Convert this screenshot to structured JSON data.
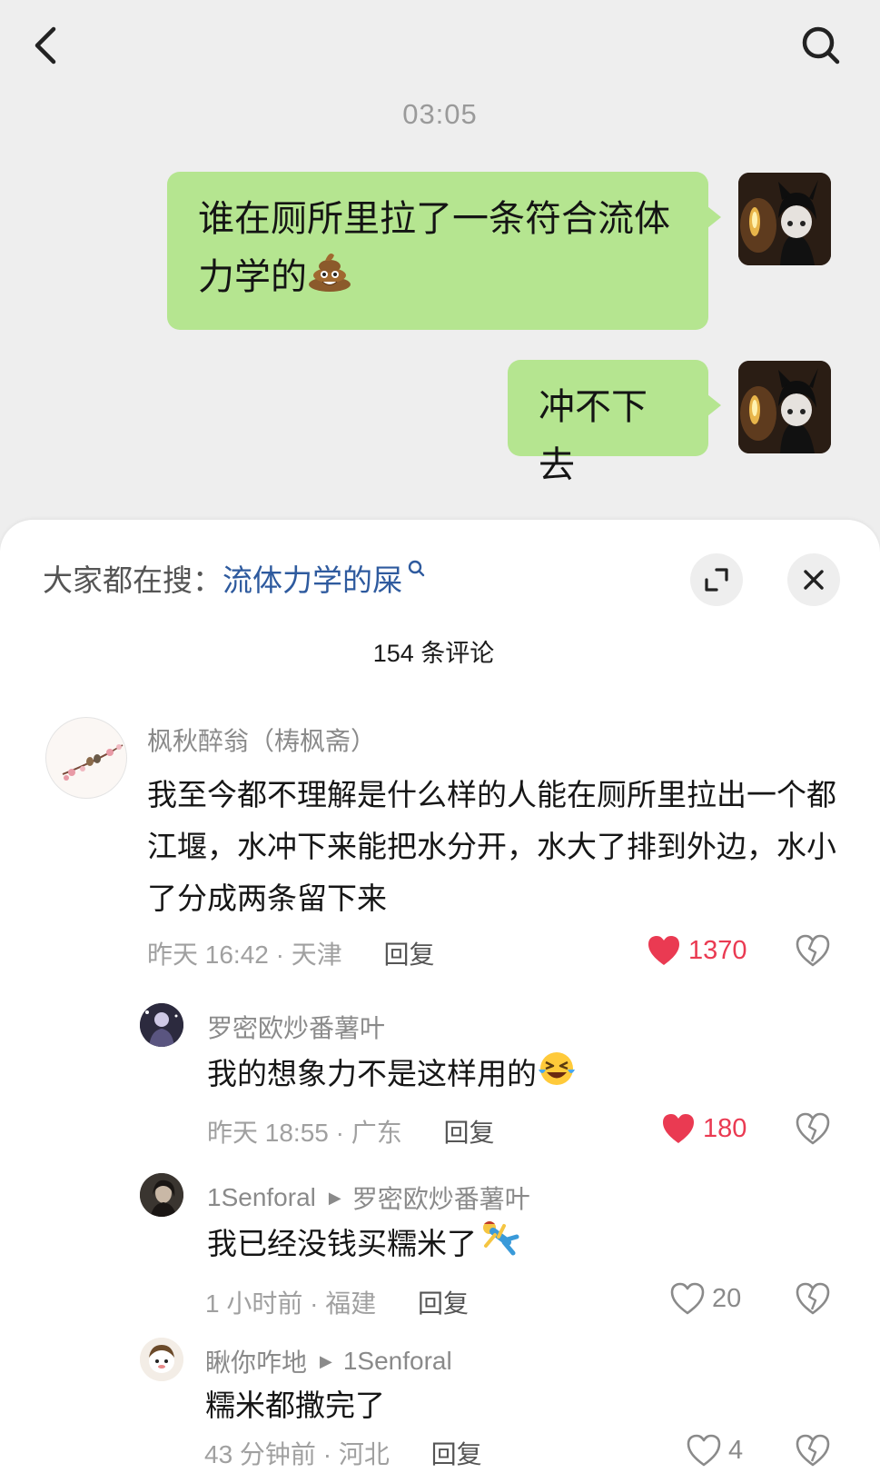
{
  "chat": {
    "time": "03:05",
    "messages": [
      {
        "text": "谁在厕所里拉了一条符合流体力学的",
        "emoji": "poop-emoji"
      },
      {
        "text": "冲不下去"
      }
    ]
  },
  "sheet": {
    "search_prefix": "大家都在搜：",
    "search_term": "流体力学的屎",
    "comment_count": "154 条评论"
  },
  "comments": [
    {
      "name": "枫秋醉翁（梼枫斋）",
      "text": "我至今都不理解是什么样的人能在厕所里拉出一个都江堰，水冲下来能把水分开，水大了排到外边，水小了分成两条留下来",
      "time": "昨天 16:42",
      "sep": "·",
      "region": "天津",
      "reply": "回复",
      "likes": "1370"
    },
    {
      "name": "罗密欧炒番薯叶",
      "text": "我的想象力不是这样用的",
      "emoji": "laughing-crying-emoji",
      "time": "昨天 18:55",
      "sep": "·",
      "region": "广东",
      "reply": "回复",
      "likes": "180"
    },
    {
      "name": "1Senforal",
      "reply_to": "罗密欧炒番薯叶",
      "text": "我已经没钱买糯米了",
      "emoji": "fallen-person-emoji",
      "time": "1 小时前",
      "sep": "·",
      "region": "福建",
      "reply": "回复",
      "likes": "20"
    },
    {
      "name": "瞅你咋地",
      "reply_to": "1Senforal",
      "text": "糯米都撒完了",
      "time": "43 分钟前",
      "sep": "·",
      "region": "河北",
      "reply": "回复",
      "likes": "4"
    }
  ],
  "colors": {
    "bubble": "#b5e590",
    "liked": "#ea3a52",
    "search_term": "#2e5a9e"
  }
}
